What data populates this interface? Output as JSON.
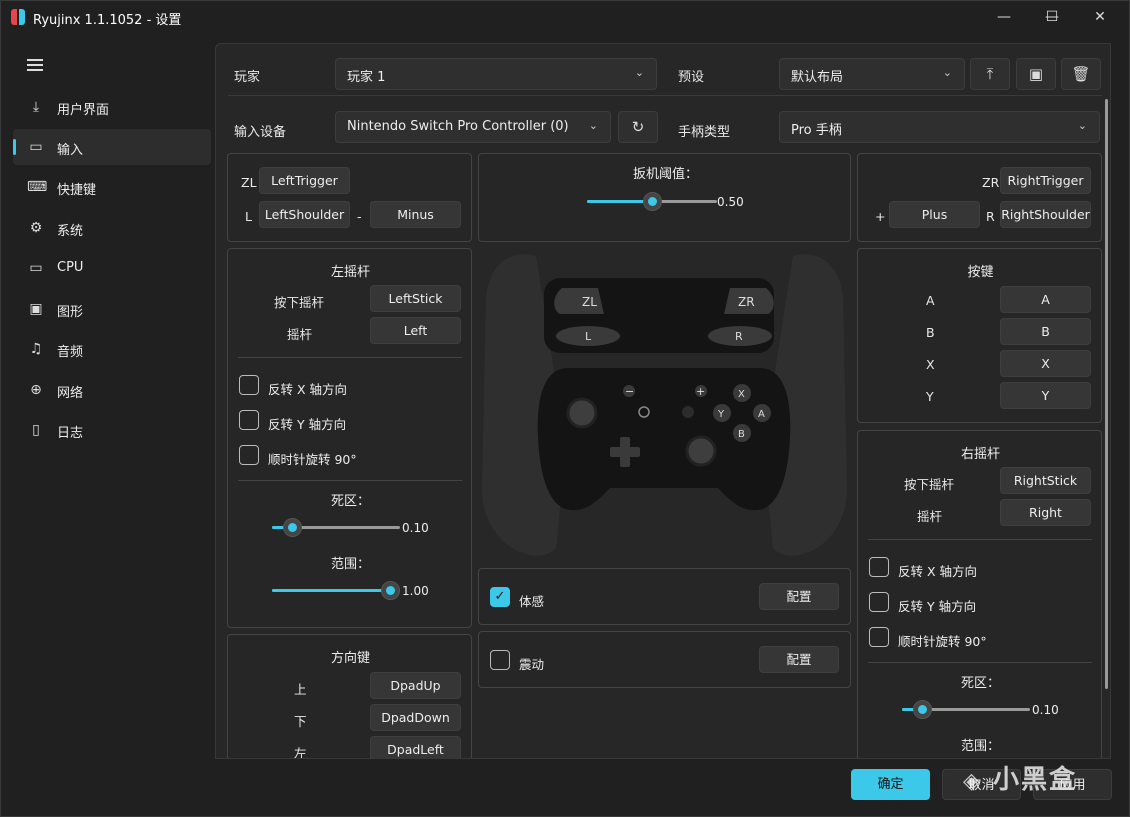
{
  "window": {
    "title": "Ryujinx 1.1.1052 - 设置",
    "controls": {
      "minimize": "—",
      "maximize": "☐",
      "close": "✕"
    }
  },
  "sidebar": {
    "items": [
      {
        "label": "用户界面",
        "icon": "ui-icon",
        "glyph": "⤓"
      },
      {
        "label": "输入",
        "icon": "gamepad-icon",
        "glyph": "▭"
      },
      {
        "label": "快捷键",
        "icon": "keyboard-icon",
        "glyph": "⌨"
      },
      {
        "label": "系统",
        "icon": "gear-icon",
        "glyph": "⚙"
      },
      {
        "label": "CPU",
        "icon": "cpu-icon",
        "glyph": "▭"
      },
      {
        "label": "图形",
        "icon": "image-icon",
        "glyph": "▣"
      },
      {
        "label": "音频",
        "icon": "music-icon",
        "glyph": "♫"
      },
      {
        "label": "网络",
        "icon": "globe-icon",
        "glyph": "⊕"
      },
      {
        "label": "日志",
        "icon": "document-icon",
        "glyph": "▯"
      }
    ],
    "active_index": 1
  },
  "header": {
    "player_label": "玩家",
    "player_value": "玩家 1",
    "preset_label": "预设",
    "preset_value": "默认布局",
    "device_label": "输入设备",
    "device_value": "Nintendo Switch Pro Controller (0)",
    "controller_type_label": "手柄类型",
    "controller_type_value": "Pro 手柄"
  },
  "left_shoulder": {
    "zl_label": "ZL",
    "zl_value": "LeftTrigger",
    "l_label": "L",
    "l_value": "LeftShoulder",
    "minus_label": "-",
    "minus_value": "Minus"
  },
  "trigger": {
    "title": "扳机阈值：",
    "value_text": "0.50",
    "value": 0.5
  },
  "right_shoulder": {
    "zr_label": "ZR",
    "zr_value": "RightTrigger",
    "plus_label": "+",
    "plus_value": "Plus",
    "r_label": "R",
    "r_value": "RightShoulder"
  },
  "left_stick": {
    "title": "左摇杆",
    "press_label": "按下摇杆",
    "press_value": "LeftStick",
    "stick_label": "摇杆",
    "stick_value": "Left",
    "invert_x": "反转 X 轴方向",
    "invert_y": "反转 Y 轴方向",
    "rotate": "顺时针旋转 90°",
    "deadzone_label": "死区：",
    "deadzone_text": "0.10",
    "deadzone": 0.1,
    "range_label": "范围：",
    "range_text": "1.00",
    "range": 1.0
  },
  "dpad": {
    "title": "方向键",
    "up_label": "上",
    "up_value": "DpadUp",
    "down_label": "下",
    "down_value": "DpadDown",
    "left_label": "左",
    "left_value": "DpadLeft"
  },
  "controller_image": {
    "zl": "ZL",
    "zr": "ZR",
    "l": "L",
    "r": "R",
    "x": "X",
    "y": "Y",
    "a": "A",
    "b": "B"
  },
  "motion": {
    "label": "体感",
    "checked": true,
    "config_label": "配置"
  },
  "rumble": {
    "label": "震动",
    "checked": false,
    "config_label": "配置"
  },
  "buttons": {
    "title": "按键",
    "rows": [
      {
        "label": "A",
        "value": "A"
      },
      {
        "label": "B",
        "value": "B"
      },
      {
        "label": "X",
        "value": "X"
      },
      {
        "label": "Y",
        "value": "Y"
      }
    ]
  },
  "right_stick": {
    "title": "右摇杆",
    "press_label": "按下摇杆",
    "press_value": "RightStick",
    "stick_label": "摇杆",
    "stick_value": "Right",
    "invert_x": "反转 X 轴方向",
    "invert_y": "反转 Y 轴方向",
    "rotate": "顺时针旋转 90°",
    "deadzone_label": "死区：",
    "deadzone_text": "0.10",
    "deadzone": 0.1,
    "range_label": "范围："
  },
  "footer": {
    "ok": "确定",
    "cancel": "取消",
    "apply": "应用"
  },
  "watermark": "小黑盒",
  "colors": {
    "accent": "#3cc8e8",
    "background": "#202020",
    "panel": "#262626"
  }
}
